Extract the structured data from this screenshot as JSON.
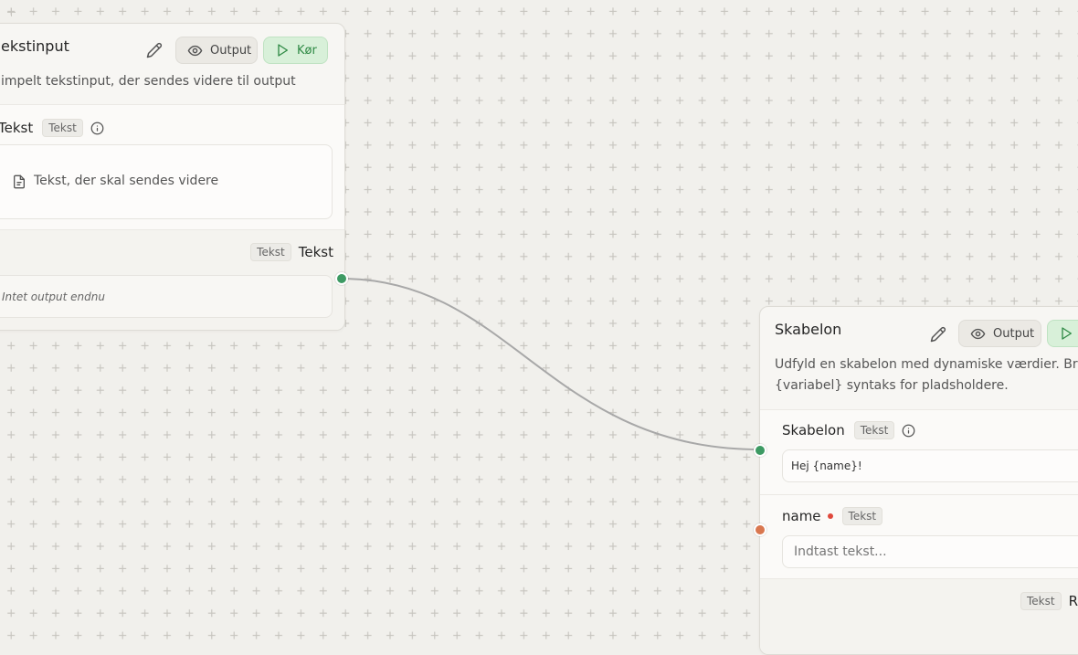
{
  "colors": {
    "canvas_bg": "#f1f0ec",
    "connected_port": "#3d9a63",
    "unconnected_port": "#d9774f",
    "run_button_bg": "#d8f0d9",
    "run_button_text": "#2f8a45",
    "edge": "#a8a8a8"
  },
  "node_text_input": {
    "title": "ekstinput",
    "edit_icon": "pencil-icon",
    "output_button_label": "Output",
    "output_button_icon": "eye-icon",
    "run_button_label": "Kør",
    "run_button_icon": "play-icon",
    "description": "impelt tekstinput, der sendes videre til output",
    "input": {
      "label": "Tekst",
      "type_tag": "Tekst",
      "info_icon": "info-icon",
      "placeholder": "Tekst, der skal sendes videre",
      "placeholder_icon": "file-text-icon"
    },
    "output": {
      "type_tag": "Tekst",
      "label": "Tekst",
      "empty_text": "Intet output endnu"
    }
  },
  "node_template": {
    "title": "Skabelon",
    "edit_icon": "pencil-icon",
    "output_button_label": "Output",
    "output_button_icon": "eye-icon",
    "run_button_icon": "play-icon",
    "description_line1": "Udfyld en skabelon med dynamiske værdier. Brug",
    "description_line2": "{variabel} syntaks for pladsholdere.",
    "template_field": {
      "label": "Skabelon",
      "type_tag": "Tekst",
      "info_icon": "info-icon",
      "value": "Hej {name}!"
    },
    "name_field": {
      "label": "name",
      "required": true,
      "type_tag": "Tekst",
      "placeholder": "Indtast tekst..."
    },
    "output": {
      "type_tag": "Tekst",
      "label": "Re"
    }
  }
}
